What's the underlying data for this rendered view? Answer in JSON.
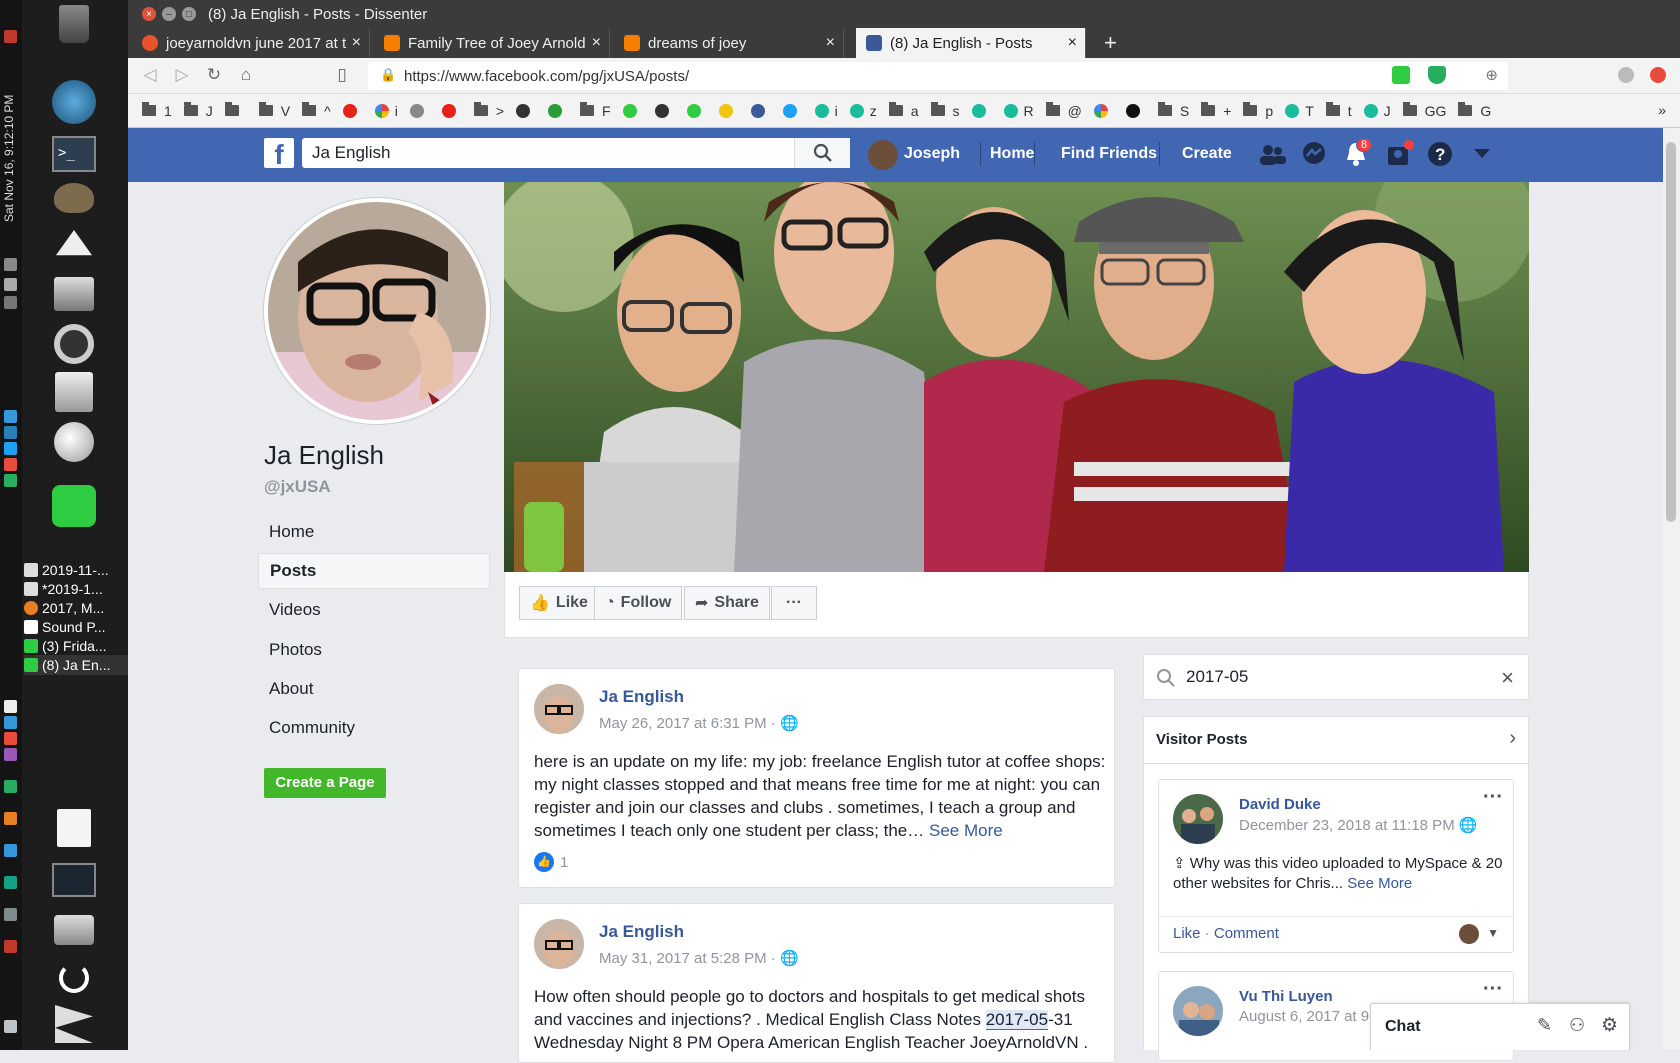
{
  "desktop": {
    "clock": "Sat Nov 16, 9:12:10 PM",
    "taskbar_items": [
      "2019-11-...",
      "*2019-1...",
      "2017, M...",
      "Sound P...",
      "(3) Frida...",
      "(8) Ja En..."
    ]
  },
  "browser": {
    "window_title": "(8) Ja English - Posts - Dissenter",
    "tabs": [
      {
        "label": "joeyarnoldvn june 2017 at t",
        "color": "#e8522c"
      },
      {
        "label": "Family Tree of Joey Arnold",
        "color": "#f57d00"
      },
      {
        "label": "dreams of joey",
        "color": "#f57d00"
      },
      {
        "label": "(8) Ja English - Posts",
        "color": "#3b5998"
      }
    ],
    "new_tab": "+",
    "url": "https://www.facebook.com/pg/jxUSA/posts/",
    "bookmarks": [
      {
        "label": "1",
        "kind": "folder"
      },
      {
        "label": "J",
        "kind": "folder"
      },
      {
        "label": "",
        "kind": "folder"
      },
      {
        "label": "V",
        "kind": "folder"
      },
      {
        "label": "^",
        "kind": "folder"
      },
      {
        "label": "",
        "kind": "dot",
        "color": "#e62117"
      },
      {
        "label": "i",
        "kind": "g"
      },
      {
        "label": "",
        "kind": "dot",
        "color": "#888"
      },
      {
        "label": "",
        "kind": "dot",
        "color": "#e62117"
      },
      {
        "label": ">",
        "kind": "folder"
      },
      {
        "label": "",
        "kind": "dot",
        "color": "#333"
      },
      {
        "label": "",
        "kind": "dot",
        "color": "#2a9d3a"
      },
      {
        "label": "F",
        "kind": "folder"
      },
      {
        "label": "",
        "kind": "dot",
        "color": "#2ecc40"
      },
      {
        "label": "",
        "kind": "dot",
        "color": "#333"
      },
      {
        "label": "",
        "kind": "dot",
        "color": "#2ecc40"
      },
      {
        "label": "",
        "kind": "dot",
        "color": "#f1c40f"
      },
      {
        "label": "",
        "kind": "dot",
        "color": "#3b5998"
      },
      {
        "label": "",
        "kind": "dot",
        "color": "#1da1f2"
      },
      {
        "label": "i",
        "kind": "dot",
        "color": "#1abc9c"
      },
      {
        "label": "z",
        "kind": "dot",
        "color": "#1abc9c"
      },
      {
        "label": "a",
        "kind": "folder"
      },
      {
        "label": "s",
        "kind": "folder"
      },
      {
        "label": "",
        "kind": "dot",
        "color": "#1abc9c"
      },
      {
        "label": "R",
        "kind": "dot",
        "color": "#1abc9c"
      },
      {
        "label": "@",
        "kind": "folder"
      },
      {
        "label": "",
        "kind": "g"
      },
      {
        "label": "",
        "kind": "dot",
        "color": "#111"
      },
      {
        "label": "S",
        "kind": "folder"
      },
      {
        "label": "+",
        "kind": "folder"
      },
      {
        "label": "p",
        "kind": "folder"
      },
      {
        "label": "T",
        "kind": "dot",
        "color": "#1abc9c"
      },
      {
        "label": "t",
        "kind": "folder"
      },
      {
        "label": "J",
        "kind": "dot",
        "color": "#1abc9c"
      },
      {
        "label": "GG",
        "kind": "folder"
      },
      {
        "label": "G",
        "kind": "folder"
      }
    ]
  },
  "facebook": {
    "search_value": "Ja English",
    "user_name": "Joseph",
    "nav": [
      "Home",
      "Find Friends",
      "Create"
    ],
    "notification_count": "8",
    "page": {
      "name": "Ja English",
      "handle": "@jxUSA",
      "menu": [
        "Home",
        "Posts",
        "Videos",
        "Photos",
        "About",
        "Community"
      ],
      "active_menu": "Posts",
      "create_page_label": "Create a Page",
      "actions": {
        "like": "Like",
        "follow": "Follow",
        "share": "Share",
        "more": "···"
      }
    },
    "posts": [
      {
        "author": "Ja English",
        "date": "May 26, 2017 at 6:31 PM",
        "text": "here is an update on my life: my job: freelance English tutor at coffee shops: my night classes stopped and that means free time for me at night: you can register and join our classes and clubs . sometimes, I teach a group and sometimes I teach only one student per class; the…",
        "see_more": "See More",
        "likes": "1"
      },
      {
        "author": "Ja English",
        "date": "May 31, 2017 at 5:28 PM",
        "text_before": "How often should people go to doctors and hospitals to get medical shots and vaccines and injections? . Medical English Class Notes ",
        "text_highlight": "2017-05",
        "text_after": "-31 Wednesday Night 8 PM Opera American English Teacher JoeyArnoldVN ."
      }
    ],
    "search_posts_value": "2017-05",
    "visitor_posts": {
      "title": "Visitor Posts",
      "items": [
        {
          "author": "David Duke",
          "date": "December 23, 2018 at 11:18 PM",
          "text": "Why was this video uploaded to MySpace & 20 other websites for Chris...",
          "see_more": "See More",
          "like": "Like",
          "sep": "·",
          "comment": "Comment"
        },
        {
          "author": "Vu Thi Luyen",
          "date": "August 6, 2017 at 9"
        }
      ]
    },
    "chat_label": "Chat"
  }
}
